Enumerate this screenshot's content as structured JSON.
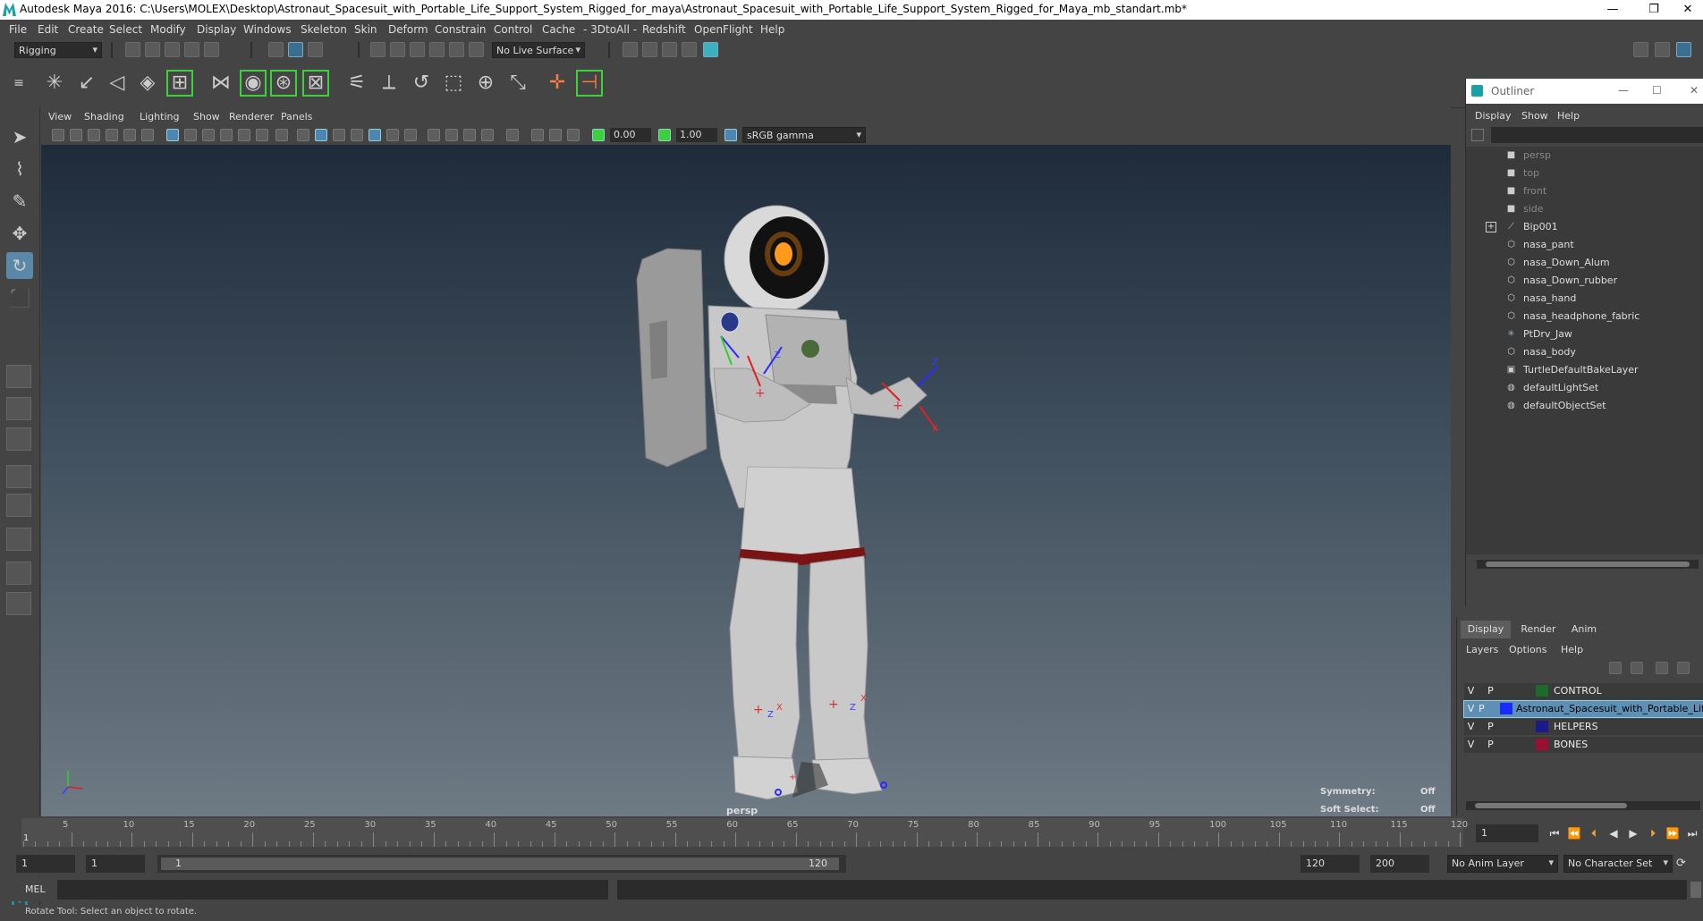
{
  "window": {
    "title": "Autodesk Maya 2016: C:\\Users\\MOLEX\\Desktop\\Astronaut_Spacesuit_with_Portable_Life_Support_System_Rigged_for_maya\\Astronaut_Spacesuit_with_Portable_Life_Support_System_Rigged_for_Maya_mb_standart.mb*",
    "minimize": "—",
    "restore": "❐",
    "close": "✕"
  },
  "menubar": [
    "File",
    "Edit",
    "Create",
    "Select",
    "Modify",
    "Display",
    "Windows",
    "Skeleton",
    "Skin",
    "Deform",
    "Constrain",
    "Control",
    "Cache",
    "- 3DtoAll -",
    "Redshift",
    "OpenFlight",
    "Help"
  ],
  "statusline": {
    "menuset": "Rigging",
    "live_surface": "No Live Surface"
  },
  "viewport": {
    "menu": [
      "View",
      "Shading",
      "Lighting",
      "Show",
      "Renderer",
      "Panels"
    ],
    "exposure": "0.00",
    "gamma": "1.00",
    "colorspace": "sRGB gamma",
    "camera_label": "persp",
    "symmetry_label": "Symmetry:",
    "symmetry_value": "Off",
    "softselect_label": "Soft Select:",
    "softselect_value": "Off"
  },
  "outliner": {
    "title": "Outliner",
    "menu": [
      "Display",
      "Show",
      "Help"
    ],
    "items": [
      {
        "label": "persp",
        "icon": "camera-icon",
        "dim": true
      },
      {
        "label": "top",
        "icon": "camera-icon",
        "dim": true
      },
      {
        "label": "front",
        "icon": "camera-icon",
        "dim": true
      },
      {
        "label": "side",
        "icon": "camera-icon",
        "dim": true
      },
      {
        "label": "Bip001",
        "icon": "joint-icon",
        "dim": false
      },
      {
        "label": "nasa_pant",
        "icon": "mesh-icon",
        "dim": false
      },
      {
        "label": "nasa_Down_Alum",
        "icon": "mesh-icon",
        "dim": false
      },
      {
        "label": "nasa_Down_rubber",
        "icon": "mesh-icon",
        "dim": false
      },
      {
        "label": "nasa_hand",
        "icon": "mesh-icon",
        "dim": false
      },
      {
        "label": "nasa_headphone_fabric",
        "icon": "mesh-icon",
        "dim": false
      },
      {
        "label": "PtDrv_Jaw",
        "icon": "locator-icon",
        "dim": false
      },
      {
        "label": "nasa_body",
        "icon": "mesh-icon",
        "dim": false
      },
      {
        "label": "TurtleDefaultBakeLayer",
        "icon": "bake-layer-icon",
        "dim": false
      },
      {
        "label": "defaultLightSet",
        "icon": "set-icon",
        "dim": false
      },
      {
        "label": "defaultObjectSet",
        "icon": "set-icon",
        "dim": false
      }
    ]
  },
  "layer_editor": {
    "tabs": [
      "Display",
      "Render",
      "Anim"
    ],
    "menu": [
      "Layers",
      "Options",
      "Help"
    ],
    "visible_flag": "V",
    "playback_flag": "P",
    "layers": [
      {
        "name": "CONTROL",
        "color": "#1d6b2a"
      },
      {
        "name": "Astronaut_Spacesuit_with_Portable_Lif",
        "color": "#1a2bff"
      },
      {
        "name": "HELPERS",
        "color": "#1a1a8a"
      },
      {
        "name": "BONES",
        "color": "#9a1030"
      }
    ]
  },
  "timeline": {
    "ticks": [
      "5",
      "10",
      "15",
      "20",
      "25",
      "30",
      "35",
      "40",
      "45",
      "50",
      "55",
      "60",
      "65",
      "70",
      "75",
      "80",
      "85",
      "90",
      "95",
      "100",
      "105",
      "110",
      "115",
      "120"
    ],
    "start_label": "1",
    "current_frame": "1"
  },
  "range": {
    "start_field": "1",
    "playback_start": "1",
    "slider_start": "1",
    "slider_end": "120",
    "playback_end": "120",
    "end_field": "200",
    "anim_layer": "No Anim Layer",
    "character_set": "No Character Set"
  },
  "command": {
    "lang": "MEL"
  },
  "helpline": "Rotate Tool: Select an object to rotate."
}
